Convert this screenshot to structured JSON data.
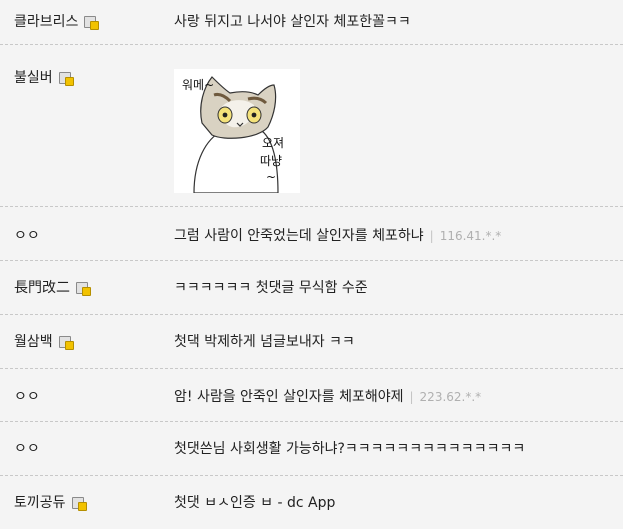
{
  "comments": [
    {
      "nick": "클라브리스",
      "has_badge": true,
      "text": "사랑 뒤지고 나서야 살인자 체포한꼴ㅋㅋ",
      "ip": ""
    },
    {
      "nick": "불실버",
      "has_badge": true,
      "text": "",
      "ip": "",
      "sticker": {
        "line1": "워메~",
        "line2": "오져",
        "line3": "따냥",
        "line4": "~"
      }
    },
    {
      "nick": "ㅇㅇ",
      "has_badge": false,
      "text": "그럼 사람이 안죽었는데 살인자를 체포하냐",
      "ip": "116.41.*.*"
    },
    {
      "nick": "長門改二",
      "has_badge": true,
      "text": "ㅋㅋㅋㅋㅋㅋ 첫댓글 무식함 수준",
      "ip": ""
    },
    {
      "nick": "월삼백",
      "has_badge": true,
      "text": "첫댁 박제하게 념글보내자 ㅋㅋ",
      "ip": ""
    },
    {
      "nick": "ㅇㅇ",
      "has_badge": false,
      "text": "암! 사람을 안죽인 살인자를 체포해야제",
      "ip": "223.62.*.*"
    },
    {
      "nick": "ㅇㅇ",
      "has_badge": false,
      "text": "첫댓쓴님 사회생활 가능하냐?ㅋㅋㅋㅋㅋㅋㅋㅋㅋㅋㅋㅋㅋㅋ",
      "ip": ""
    },
    {
      "nick": "토끼공듀",
      "has_badge": true,
      "text": "첫댓 ㅂㅅ인증 ㅂ - dc App",
      "ip": ""
    }
  ]
}
